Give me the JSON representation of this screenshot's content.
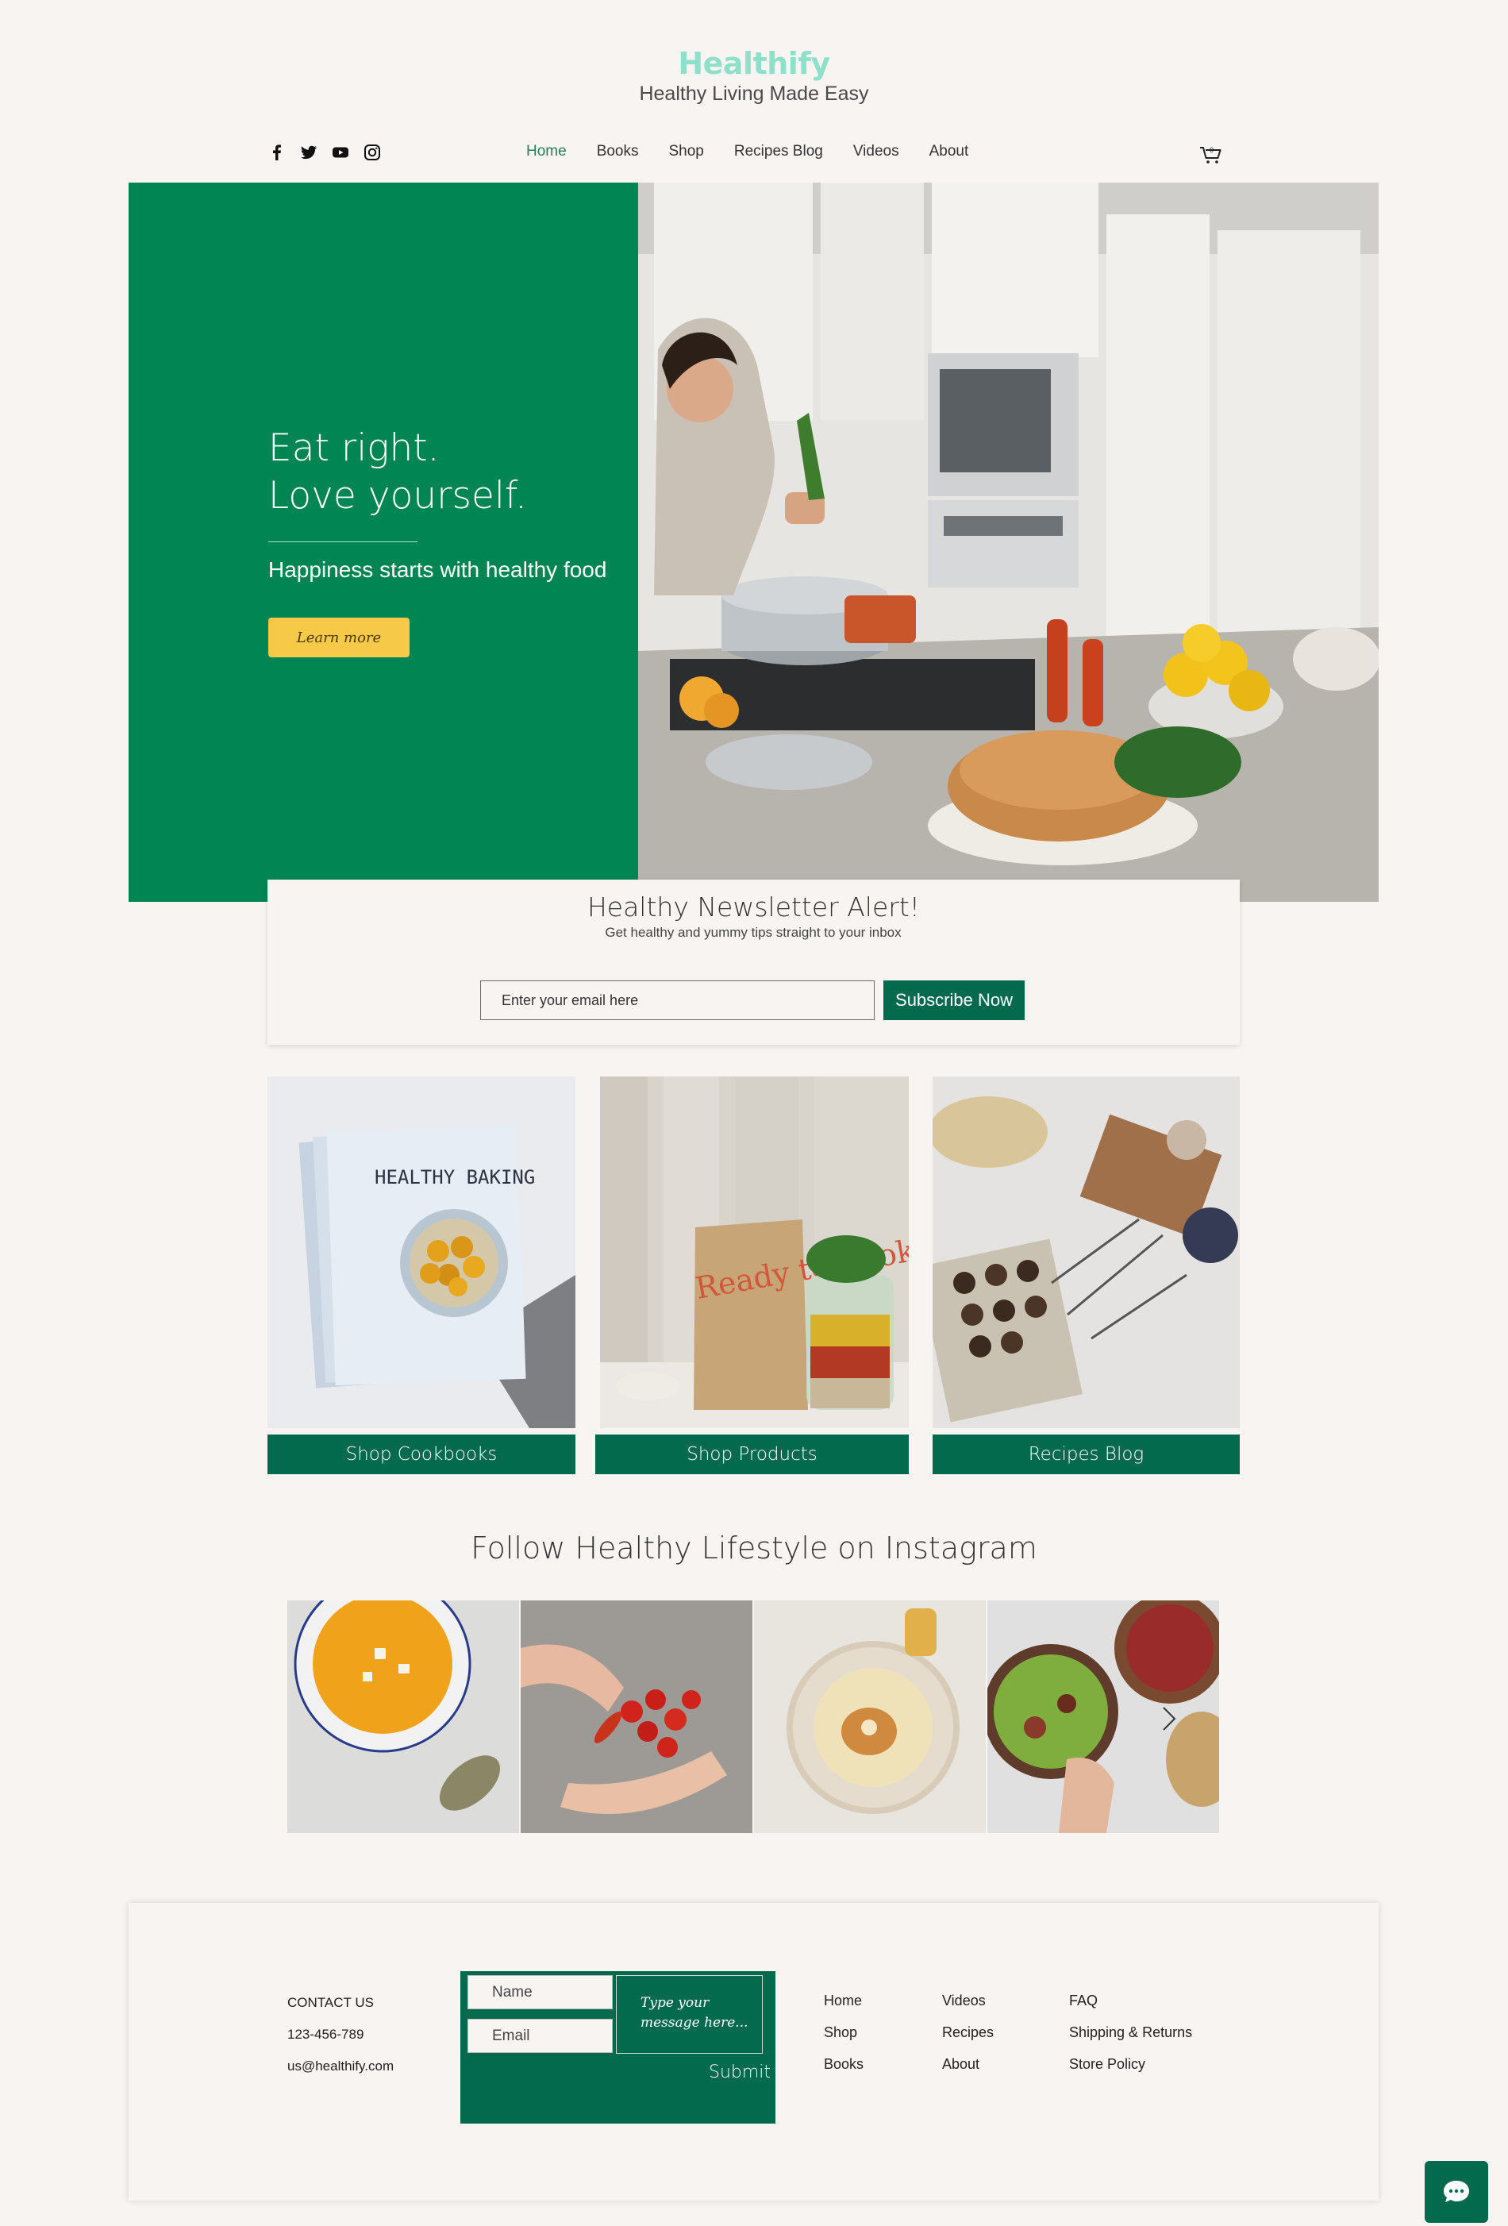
{
  "brand": {
    "name": "Healthify",
    "tagline": "Healthy Living Made Easy"
  },
  "social": [
    "facebook-icon",
    "twitter-icon",
    "youtube-icon",
    "instagram-icon"
  ],
  "nav": {
    "items": [
      "Home",
      "Books",
      "Shop",
      "Recipes Blog",
      "Videos",
      "About"
    ],
    "active": "Home",
    "cart_count": "0"
  },
  "hero": {
    "line1": "Eat right.",
    "line2": "Love yourself.",
    "subtitle": "Happiness starts with healthy food",
    "cta": "Learn more",
    "slides": 2,
    "current_slide": 2
  },
  "newsletter": {
    "title": "Healthy Newsletter Alert!",
    "subtitle": "Get healthy and yummy tips straight to your inbox",
    "placeholder": "Enter your email here",
    "button": "Subscribe Now"
  },
  "cards": [
    {
      "label": "Shop Cookbooks",
      "book_title": "HEALTHY BAKING"
    },
    {
      "label": "Shop Products",
      "pouch_text": "Ready to Cook"
    },
    {
      "label": "Recipes Blog"
    }
  ],
  "instagram": {
    "title": "Follow Healthy Lifestyle on Instagram"
  },
  "footer": {
    "contact_heading": "CONTACT US",
    "phone": "123-456-789",
    "email": "us@healthify.com",
    "form": {
      "name_placeholder": "Name",
      "email_placeholder": "Email",
      "message_placeholder": "Type your message here...",
      "submit": "Submit"
    },
    "links_col1": [
      "Home",
      "Shop",
      "Books"
    ],
    "links_col2": [
      "Videos",
      "Recipes",
      "About"
    ],
    "links_col3": [
      "FAQ",
      "Shipping & Returns",
      "Store Policy"
    ]
  },
  "colors": {
    "brand_mint": "#8fe0cb",
    "hero_green": "#018552",
    "button_teal": "#036a4e",
    "cta_yellow": "#f7c948",
    "background": "#f7f4f1"
  }
}
